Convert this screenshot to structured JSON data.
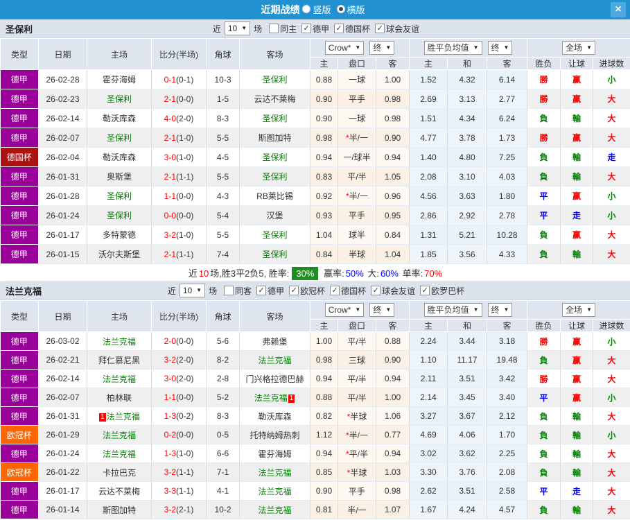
{
  "topbar": {
    "title": "近期战绩",
    "radios": [
      {
        "label": "竖版",
        "checked": false
      },
      {
        "label": "横版",
        "checked": true
      }
    ],
    "close_icon": "×"
  },
  "colors": {
    "topbar_blue": "#2191d0",
    "league_map": {
      "德甲": "#990099",
      "德国杯": "#aa1111",
      "欧冠杯": "#ff6600"
    },
    "result_map": {
      "r": "#ff0000",
      "g": "#008000",
      "b": "#0000ff"
    },
    "team_green": "#008000",
    "summary_green_bg": "#1e8c1e"
  },
  "table_header": {
    "base_cols": [
      "类型",
      "日期",
      "主场",
      "比分(半场)",
      "角球",
      "客场"
    ],
    "groups": [
      {
        "selects": [
          "Crow*",
          "终"
        ],
        "cols": [
          "主",
          "盘口",
          "客"
        ]
      },
      {
        "selects": [
          "胜平负均值",
          "终"
        ],
        "cols": [
          "主",
          "和",
          "客"
        ]
      },
      {
        "selects": [
          "全场"
        ],
        "cols": [
          "胜负",
          "让球",
          "进球数"
        ]
      }
    ]
  },
  "sections": [
    {
      "team": "圣保利",
      "filter": {
        "prefix": "近",
        "count": "10",
        "suffix": "场",
        "scope": {
          "label": "同主",
          "checked": false
        },
        "leagues": [
          {
            "label": "德甲",
            "checked": true
          },
          {
            "label": "德国杯",
            "checked": true
          },
          {
            "label": "球会友谊",
            "checked": true
          }
        ]
      },
      "rows": [
        {
          "league": "德甲",
          "date": "26-02-28",
          "home": "霍芬海姆",
          "home_green": false,
          "score": "0-1",
          "half": "(0-1)",
          "corner": "10-3",
          "away": "圣保利",
          "away_green": true,
          "crow": [
            "0.88",
            "一球",
            "1.00"
          ],
          "avg": [
            "1.52",
            "4.32",
            "6.14"
          ],
          "results": [
            [
              "勝",
              "r"
            ],
            [
              "赢",
              "r"
            ],
            [
              "小",
              "g"
            ]
          ]
        },
        {
          "league": "德甲",
          "date": "26-02-23",
          "home": "圣保利",
          "home_green": true,
          "score": "2-1",
          "half": "(0-0)",
          "corner": "1-5",
          "away": "云达不莱梅",
          "away_green": false,
          "crow": [
            "0.90",
            "平手",
            "0.98"
          ],
          "avg": [
            "2.69",
            "3.13",
            "2.77"
          ],
          "results": [
            [
              "勝",
              "r"
            ],
            [
              "赢",
              "r"
            ],
            [
              "大",
              "r"
            ]
          ]
        },
        {
          "league": "德甲",
          "date": "26-02-14",
          "home": "勒沃库森",
          "home_green": false,
          "score": "4-0",
          "half": "(2-0)",
          "corner": "8-3",
          "away": "圣保利",
          "away_green": true,
          "crow": [
            "0.90",
            "一球",
            "0.98"
          ],
          "avg": [
            "1.51",
            "4.34",
            "6.24"
          ],
          "results": [
            [
              "負",
              "g"
            ],
            [
              "輸",
              "g"
            ],
            [
              "大",
              "r"
            ]
          ]
        },
        {
          "league": "德甲",
          "date": "26-02-07",
          "home": "圣保利",
          "home_green": true,
          "score": "2-1",
          "half": "(1-0)",
          "corner": "5-5",
          "away": "斯图加特",
          "away_green": false,
          "crow": [
            "0.98",
            "*半/一",
            "0.90"
          ],
          "avg": [
            "4.77",
            "3.78",
            "1.73"
          ],
          "results": [
            [
              "勝",
              "r"
            ],
            [
              "赢",
              "r"
            ],
            [
              "大",
              "r"
            ]
          ]
        },
        {
          "league": "德国杯",
          "date": "26-02-04",
          "home": "勒沃库森",
          "home_green": false,
          "score": "3-0",
          "half": "(1-0)",
          "corner": "4-5",
          "away": "圣保利",
          "away_green": true,
          "crow": [
            "0.94",
            "一/球半",
            "0.94"
          ],
          "avg": [
            "1.40",
            "4.80",
            "7.25"
          ],
          "results": [
            [
              "負",
              "g"
            ],
            [
              "輸",
              "g"
            ],
            [
              "走",
              "b"
            ]
          ]
        },
        {
          "league": "德甲",
          "date": "26-01-31",
          "home": "奥斯堡",
          "home_green": false,
          "score": "2-1",
          "half": "(1-1)",
          "corner": "5-5",
          "away": "圣保利",
          "away_green": true,
          "crow": [
            "0.83",
            "平/半",
            "1.05"
          ],
          "avg": [
            "2.08",
            "3.10",
            "4.03"
          ],
          "results": [
            [
              "負",
              "g"
            ],
            [
              "輸",
              "g"
            ],
            [
              "大",
              "r"
            ]
          ]
        },
        {
          "league": "德甲",
          "date": "26-01-28",
          "home": "圣保利",
          "home_green": true,
          "score": "1-1",
          "half": "(0-0)",
          "corner": "4-3",
          "away": "RB莱比锡",
          "away_green": false,
          "crow": [
            "0.92",
            "*半/一",
            "0.96"
          ],
          "avg": [
            "4.56",
            "3.63",
            "1.80"
          ],
          "results": [
            [
              "平",
              "b"
            ],
            [
              "赢",
              "r"
            ],
            [
              "小",
              "g"
            ]
          ]
        },
        {
          "league": "德甲",
          "date": "26-01-24",
          "home": "圣保利",
          "home_green": true,
          "score": "0-0",
          "half": "(0-0)",
          "corner": "5-4",
          "away": "汉堡",
          "away_green": false,
          "crow": [
            "0.93",
            "平手",
            "0.95"
          ],
          "avg": [
            "2.86",
            "2.92",
            "2.78"
          ],
          "results": [
            [
              "平",
              "b"
            ],
            [
              "走",
              "b"
            ],
            [
              "小",
              "g"
            ]
          ]
        },
        {
          "league": "德甲",
          "date": "26-01-17",
          "home": "多特蒙德",
          "home_green": false,
          "score": "3-2",
          "half": "(1-0)",
          "corner": "5-5",
          "away": "圣保利",
          "away_green": true,
          "crow": [
            "1.04",
            "球半",
            "0.84"
          ],
          "avg": [
            "1.31",
            "5.21",
            "10.28"
          ],
          "results": [
            [
              "負",
              "g"
            ],
            [
              "赢",
              "r"
            ],
            [
              "大",
              "r"
            ]
          ]
        },
        {
          "league": "德甲",
          "date": "26-01-15",
          "home": "沃尔夫斯堡",
          "home_green": false,
          "score": "2-1",
          "half": "(1-1)",
          "corner": "7-4",
          "away": "圣保利",
          "away_green": true,
          "crow": [
            "0.84",
            "半球",
            "1.04"
          ],
          "avg": [
            "1.85",
            "3.56",
            "4.33"
          ],
          "results": [
            [
              "負",
              "g"
            ],
            [
              "輸",
              "g"
            ],
            [
              "大",
              "r"
            ]
          ]
        }
      ],
      "summary": [
        {
          "text": "近",
          "color": "#333"
        },
        {
          "text": "10",
          "color": "#ff0000"
        },
        {
          "text": "场,胜3平2负5, 胜率:",
          "color": "#333"
        },
        {
          "text": "30%",
          "color": "#ffffff",
          "bg": "#1e8c1e"
        },
        {
          "text": " 赢率:",
          "color": "#333"
        },
        {
          "text": "50%",
          "color": "#0000ff"
        },
        {
          "text": " 大:",
          "color": "#333"
        },
        {
          "text": "60%",
          "color": "#0000ff"
        },
        {
          "text": " 单率:",
          "color": "#333"
        },
        {
          "text": "70%",
          "color": "#ff0000"
        }
      ]
    },
    {
      "team": "法兰克福",
      "filter": {
        "prefix": "近",
        "count": "10",
        "suffix": "场",
        "scope": {
          "label": "同客",
          "checked": false
        },
        "leagues": [
          {
            "label": "德甲",
            "checked": true
          },
          {
            "label": "欧冠杯",
            "checked": true
          },
          {
            "label": "德国杯",
            "checked": true
          },
          {
            "label": "球会友谊",
            "checked": true
          },
          {
            "label": "欧罗巴杯",
            "checked": true
          }
        ]
      },
      "rows": [
        {
          "league": "德甲",
          "date": "26-03-02",
          "home": "法兰克福",
          "home_green": true,
          "score": "2-0",
          "half": "(0-0)",
          "corner": "5-6",
          "away": "弗赖堡",
          "away_green": false,
          "crow": [
            "1.00",
            "平/半",
            "0.88"
          ],
          "avg": [
            "2.24",
            "3.44",
            "3.18"
          ],
          "results": [
            [
              "勝",
              "r"
            ],
            [
              "赢",
              "r"
            ],
            [
              "小",
              "g"
            ]
          ]
        },
        {
          "league": "德甲",
          "date": "26-02-21",
          "home": "拜仁慕尼黑",
          "home_green": false,
          "score": "3-2",
          "half": "(2-0)",
          "corner": "8-2",
          "away": "法兰克福",
          "away_green": true,
          "crow": [
            "0.98",
            "三球",
            "0.90"
          ],
          "avg": [
            "1.10",
            "11.17",
            "19.48"
          ],
          "results": [
            [
              "負",
              "g"
            ],
            [
              "赢",
              "r"
            ],
            [
              "大",
              "r"
            ]
          ]
        },
        {
          "league": "德甲",
          "date": "26-02-14",
          "home": "法兰克福",
          "home_green": true,
          "score": "3-0",
          "half": "(2-0)",
          "corner": "2-8",
          "away": "门兴格拉德巴赫",
          "away_green": false,
          "crow": [
            "0.94",
            "平/半",
            "0.94"
          ],
          "avg": [
            "2.11",
            "3.51",
            "3.42"
          ],
          "results": [
            [
              "勝",
              "r"
            ],
            [
              "赢",
              "r"
            ],
            [
              "大",
              "r"
            ]
          ]
        },
        {
          "league": "德甲",
          "date": "26-02-07",
          "home": "柏林联",
          "home_green": false,
          "score": "1-1",
          "half": "(0-0)",
          "corner": "5-2",
          "away": "法兰克福",
          "away_green": true,
          "away_badge": {
            "text": "1",
            "pos": "after"
          },
          "crow": [
            "0.88",
            "平/半",
            "1.00"
          ],
          "avg": [
            "2.14",
            "3.45",
            "3.40"
          ],
          "results": [
            [
              "平",
              "b"
            ],
            [
              "赢",
              "r"
            ],
            [
              "小",
              "g"
            ]
          ]
        },
        {
          "league": "德甲",
          "date": "26-01-31",
          "home": "法兰克福",
          "home_green": true,
          "home_badge": {
            "text": "1",
            "pos": "before"
          },
          "score": "1-3",
          "half": "(0-2)",
          "corner": "8-3",
          "away": "勒沃库森",
          "away_green": false,
          "crow": [
            "0.82",
            "*半球",
            "1.06"
          ],
          "avg": [
            "3.27",
            "3.67",
            "2.12"
          ],
          "results": [
            [
              "負",
              "g"
            ],
            [
              "輸",
              "g"
            ],
            [
              "大",
              "r"
            ]
          ]
        },
        {
          "league": "欧冠杯",
          "date": "26-01-29",
          "home": "法兰克福",
          "home_green": true,
          "score": "0-2",
          "half": "(0-0)",
          "corner": "0-5",
          "away": "托特纳姆热刺",
          "away_green": false,
          "crow": [
            "1.12",
            "*半/一",
            "0.77"
          ],
          "avg": [
            "4.69",
            "4.06",
            "1.70"
          ],
          "results": [
            [
              "負",
              "g"
            ],
            [
              "輸",
              "g"
            ],
            [
              "小",
              "g"
            ]
          ]
        },
        {
          "league": "德甲",
          "date": "26-01-24",
          "home": "法兰克福",
          "home_green": true,
          "score": "1-3",
          "half": "(1-0)",
          "corner": "6-6",
          "away": "霍芬海姆",
          "away_green": false,
          "crow": [
            "0.94",
            "*平/半",
            "0.94"
          ],
          "avg": [
            "3.02",
            "3.62",
            "2.25"
          ],
          "results": [
            [
              "負",
              "g"
            ],
            [
              "輸",
              "g"
            ],
            [
              "大",
              "r"
            ]
          ]
        },
        {
          "league": "欧冠杯",
          "date": "26-01-22",
          "home": "卡拉巴克",
          "home_green": false,
          "score": "3-2",
          "half": "(1-1)",
          "corner": "7-1",
          "away": "法兰克福",
          "away_green": true,
          "crow": [
            "0.85",
            "*半球",
            "1.03"
          ],
          "avg": [
            "3.30",
            "3.76",
            "2.08"
          ],
          "results": [
            [
              "負",
              "g"
            ],
            [
              "輸",
              "g"
            ],
            [
              "大",
              "r"
            ]
          ]
        },
        {
          "league": "德甲",
          "date": "26-01-17",
          "home": "云达不莱梅",
          "home_green": false,
          "score": "3-3",
          "half": "(1-1)",
          "corner": "4-1",
          "away": "法兰克福",
          "away_green": true,
          "crow": [
            "0.90",
            "平手",
            "0.98"
          ],
          "avg": [
            "2.62",
            "3.51",
            "2.58"
          ],
          "results": [
            [
              "平",
              "b"
            ],
            [
              "走",
              "b"
            ],
            [
              "大",
              "r"
            ]
          ]
        },
        {
          "league": "德甲",
          "date": "26-01-14",
          "home": "斯图加特",
          "home_green": false,
          "score": "3-2",
          "half": "(2-1)",
          "corner": "10-2",
          "away": "法兰克福",
          "away_green": true,
          "crow": [
            "0.81",
            "半/一",
            "1.07"
          ],
          "avg": [
            "1.67",
            "4.24",
            "4.57"
          ],
          "results": [
            [
              "負",
              "g"
            ],
            [
              "輸",
              "g"
            ],
            [
              "大",
              "r"
            ]
          ]
        }
      ],
      "summary": null
    }
  ]
}
